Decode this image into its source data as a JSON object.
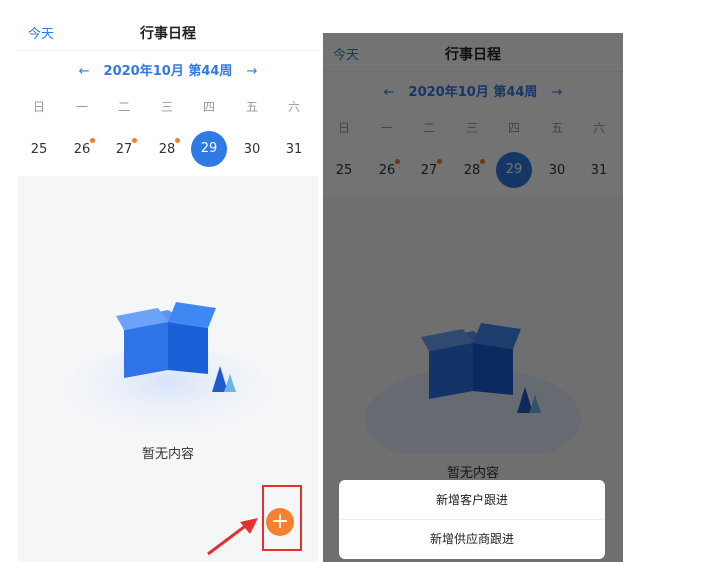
{
  "header": {
    "today_label": "今天",
    "title": "行事日程"
  },
  "week_nav": {
    "prev_arrow": "←",
    "week_label": "2020年10月 第44周",
    "next_arrow": "→"
  },
  "weekdays": [
    "日",
    "一",
    "二",
    "三",
    "四",
    "五",
    "六"
  ],
  "days": [
    {
      "label": "25",
      "has_event": false,
      "selected": false
    },
    {
      "label": "26",
      "has_event": true,
      "selected": false
    },
    {
      "label": "27",
      "has_event": true,
      "selected": false
    },
    {
      "label": "28",
      "has_event": true,
      "selected": false
    },
    {
      "label": "29",
      "has_event": false,
      "selected": true
    },
    {
      "label": "30",
      "has_event": false,
      "selected": false
    },
    {
      "label": "31",
      "has_event": false,
      "selected": false
    }
  ],
  "empty_state": {
    "text": "暂无内容",
    "icon": "empty-box-illustration"
  },
  "fab": {
    "label": "+"
  },
  "action_sheet": {
    "items": [
      {
        "label": "新增客户跟进"
      },
      {
        "label": "新增供应商跟进"
      }
    ]
  },
  "colors": {
    "accent": "#2f7ae5",
    "fab": "#f5802e",
    "event_dot": "#f07d2a",
    "highlight": "#e53030"
  }
}
